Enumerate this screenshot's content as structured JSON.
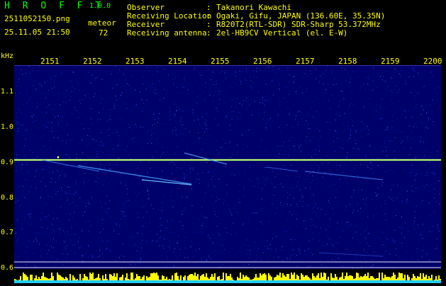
{
  "app": {
    "title": "H R O F F T",
    "version": "1.0.0"
  },
  "capture": {
    "file": "2511052150.png",
    "datetime": "25.11.05 21:50",
    "mode": "meteor",
    "count": "72"
  },
  "info": [
    {
      "key": "Observer",
      "value": "Takanori Kawachi"
    },
    {
      "key": "Receiving Location",
      "value": "Ogaki, Gifu, JAPAN (136.60E, 35.35N)"
    },
    {
      "key": "Receiver",
      "value": "R820T2(RTL-SDR) SDR-Sharp 53.372MHz"
    },
    {
      "key": "Receiving antenna",
      "value": "2el-HB9CV Vertical (el. E-W)"
    }
  ],
  "separator": ":",
  "axis": {
    "y_unit": "kHz",
    "y_ticks": [
      "1.1",
      "1.0",
      "0.9",
      "0.8",
      "0.7",
      "0.6"
    ],
    "x_ticks": [
      "2151",
      "2152",
      "2153",
      "2154",
      "2155",
      "2156",
      "2157",
      "2158",
      "2159",
      "2200"
    ]
  },
  "colors": {
    "background": "#000000",
    "label": "#ffff00",
    "title": "#00ff00",
    "waterfall": "#00006a",
    "carrier": "#aaff66"
  }
}
